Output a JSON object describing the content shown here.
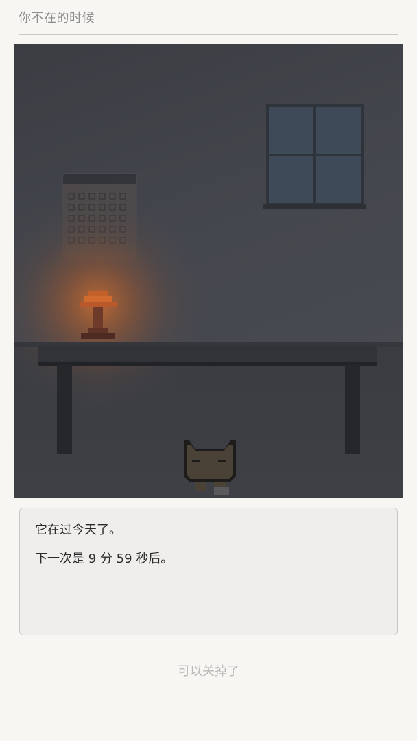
{
  "header": {
    "title": "你不在的时候"
  },
  "scene": {
    "lamp_glow_color": "#c8692e",
    "wall_color": "#44464d",
    "window_color": "#3f4a58",
    "cat_color": "#4a4236"
  },
  "dialog": {
    "line1": "它在过今天了。",
    "line2": "下一次是 9 分 59 秒后。"
  },
  "footer": {
    "close_label": "可以关掉了"
  }
}
